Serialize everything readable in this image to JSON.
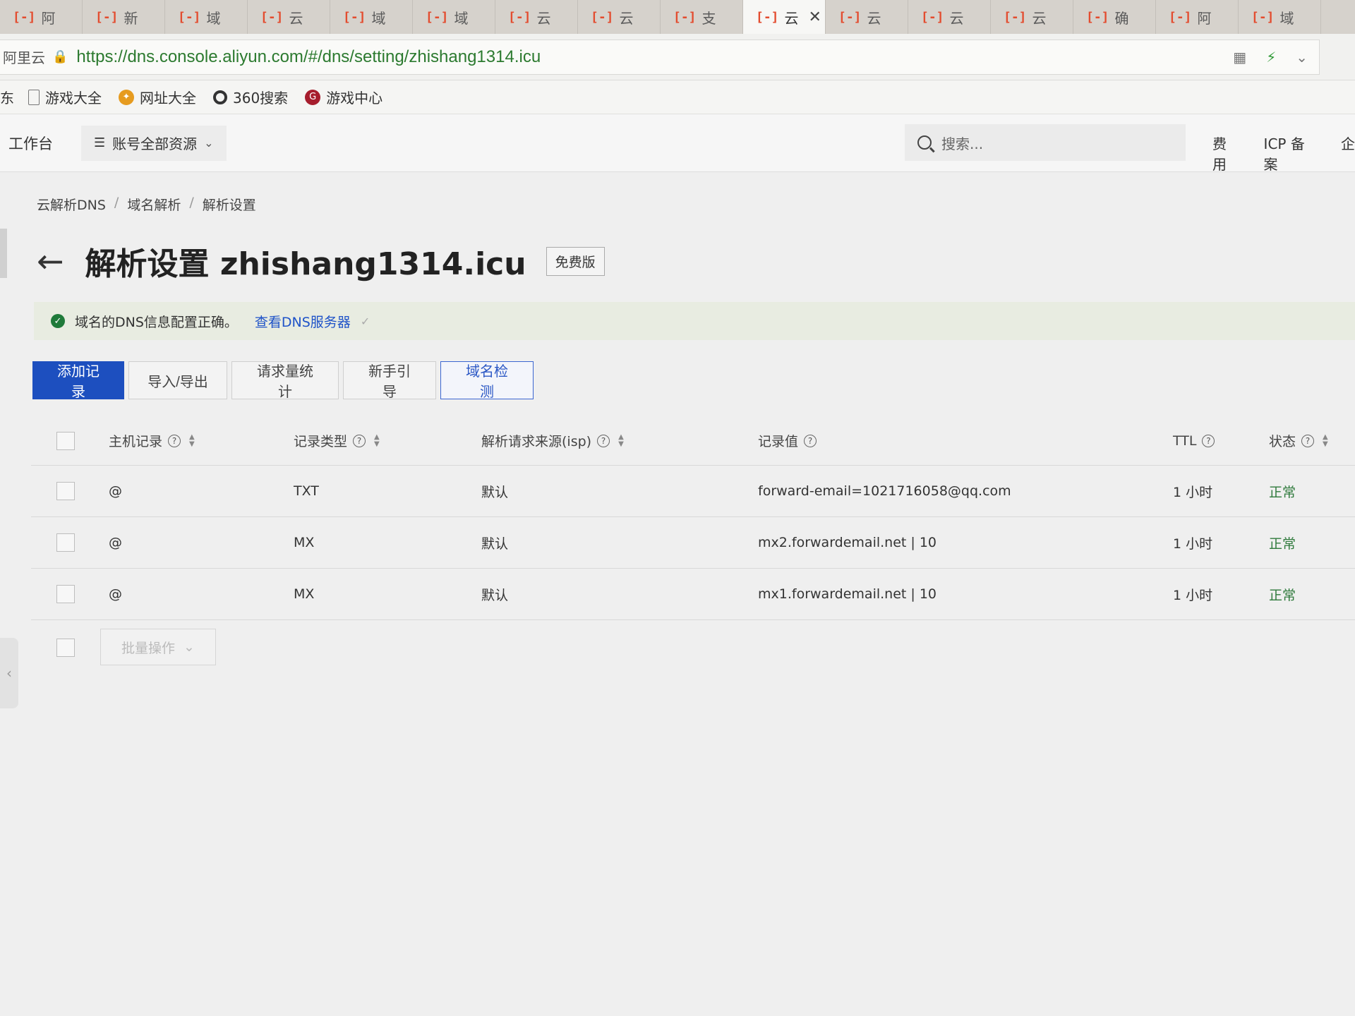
{
  "browser": {
    "tabs": [
      {
        "label": "阿",
        "active": false
      },
      {
        "label": "新",
        "active": false
      },
      {
        "label": "域",
        "active": false
      },
      {
        "label": "云",
        "active": false
      },
      {
        "label": "域",
        "active": false
      },
      {
        "label": "域",
        "active": false
      },
      {
        "label": "云",
        "active": false
      },
      {
        "label": "云",
        "active": false
      },
      {
        "label": "支",
        "active": false
      },
      {
        "label": "云",
        "active": true
      },
      {
        "label": "云",
        "active": false
      },
      {
        "label": "云",
        "active": false
      },
      {
        "label": "云",
        "active": false
      },
      {
        "label": "确",
        "active": false
      },
      {
        "label": "阿",
        "active": false
      },
      {
        "label": "域",
        "active": false
      }
    ],
    "tab_logo": "[-]",
    "close_glyph": "✕",
    "site_label": "阿里云",
    "url": "https://dns.console.aliyun.com/#/dns/setting/zhishang1314.icu",
    "bookmarks_first": "东",
    "bookmarks": [
      {
        "label": "游戏大全",
        "icon": "doc-icon"
      },
      {
        "label": "网址大全",
        "icon": "compass-icon"
      },
      {
        "label": "360搜索",
        "icon": "ring-icon"
      },
      {
        "label": "游戏中心",
        "icon": "game-icon"
      }
    ]
  },
  "header": {
    "workbench": "工作台",
    "resources": "账号全部资源",
    "search_placeholder": "搜索...",
    "links": [
      "费用",
      "ICP 备案",
      "企"
    ]
  },
  "breadcrumb": [
    "云解析DNS",
    "域名解析",
    "解析设置"
  ],
  "page": {
    "title": "解析设置 zhishang1314.icu",
    "badge": "免费版"
  },
  "notice": {
    "text": "域名的DNS信息配置正确。",
    "link": "查看DNS服务器"
  },
  "toolbar": {
    "add": "添加记录",
    "import_export": "导入/导出",
    "stats": "请求量统计",
    "guide": "新手引导",
    "check": "域名检测"
  },
  "table": {
    "columns": {
      "host": "主机记录",
      "type": "记录类型",
      "isp": "解析请求来源(isp)",
      "value": "记录值",
      "ttl": "TTL",
      "status": "状态"
    },
    "rows": [
      {
        "host": "@",
        "type": "TXT",
        "isp": "默认",
        "value": "forward-email=1021716058@qq.com",
        "ttl": "1 小时",
        "status": "正常"
      },
      {
        "host": "@",
        "type": "MX",
        "isp": "默认",
        "value": "mx2.forwardemail.net | 10",
        "ttl": "1 小时",
        "status": "正常"
      },
      {
        "host": "@",
        "type": "MX",
        "isp": "默认",
        "value": "mx1.forwardemail.net | 10",
        "ttl": "1 小时",
        "status": "正常"
      }
    ],
    "batch_label": "批量操作"
  },
  "colors": {
    "primary": "#1d4fbf",
    "status_ok": "#2f7a3c",
    "url_green": "#2c7a2f"
  }
}
